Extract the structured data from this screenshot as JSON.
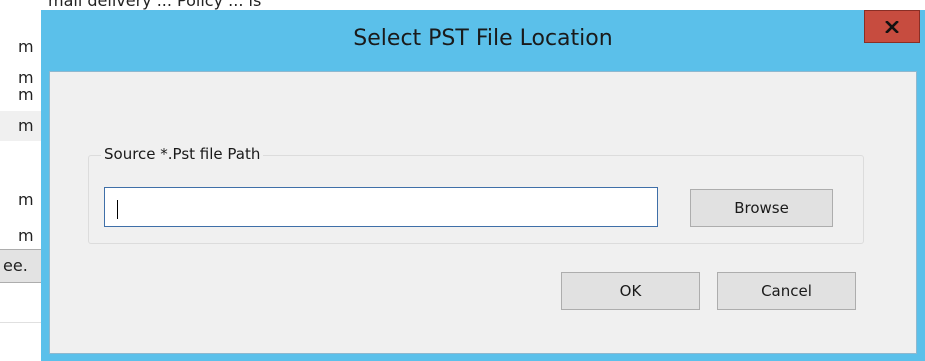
{
  "background_window": {
    "top_partial_text": "mail delivery ... Policy ... ls",
    "rows": [
      "m",
      "m",
      "m",
      "m",
      "m",
      "m"
    ],
    "button_label": "ee."
  },
  "dialog": {
    "title": "Select PST File Location",
    "close_icon": "close-icon",
    "colors": {
      "titlebar": "#5bc0ea",
      "close_button": "#c74c3f",
      "client": "#f0f0f0"
    },
    "source_group": {
      "label": "Source *.Pst file Path",
      "path_value": "",
      "browse_label": "Browse"
    },
    "ok_label": "OK",
    "cancel_label": "Cancel"
  }
}
